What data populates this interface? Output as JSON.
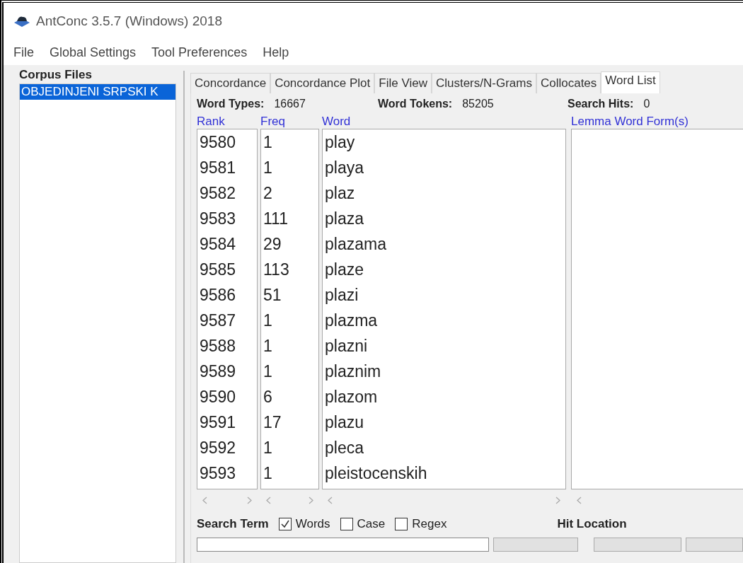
{
  "window": {
    "title": "AntConc 3.5.7 (Windows) 2018"
  },
  "menu": [
    "File",
    "Global Settings",
    "Tool Preferences",
    "Help"
  ],
  "corpus_files": {
    "heading": "Corpus Files",
    "items": [
      {
        "name": "OBJEDINJENI SRPSKI K",
        "selected": true
      }
    ]
  },
  "tabs": [
    {
      "label": "Concordance",
      "selected": false
    },
    {
      "label": "Concordance Plot",
      "selected": false
    },
    {
      "label": "File View",
      "selected": false
    },
    {
      "label": "Clusters/N-Grams",
      "selected": false
    },
    {
      "label": "Collocates",
      "selected": false
    },
    {
      "label": "Word List",
      "selected": true
    }
  ],
  "stats": [
    {
      "label": "Word Types:",
      "value": "16667"
    },
    {
      "label": "Word Tokens:",
      "value": "85205"
    },
    {
      "label": "Search Hits:",
      "value": "0"
    }
  ],
  "columns": [
    "Rank",
    "Freq",
    "Word"
  ],
  "lemma_column": "Lemma Word Form(s)",
  "rows": [
    {
      "rank": "9580",
      "freq": "1",
      "word": "play"
    },
    {
      "rank": "9581",
      "freq": "1",
      "word": "playa"
    },
    {
      "rank": "9582",
      "freq": "2",
      "word": "plaz"
    },
    {
      "rank": "9583",
      "freq": "111",
      "word": "plaza"
    },
    {
      "rank": "9584",
      "freq": "29",
      "word": "plazama"
    },
    {
      "rank": "9585",
      "freq": "113",
      "word": "plaze"
    },
    {
      "rank": "9586",
      "freq": "51",
      "word": "plazi"
    },
    {
      "rank": "9587",
      "freq": "1",
      "word": "plazma"
    },
    {
      "rank": "9588",
      "freq": "1",
      "word": "plazni"
    },
    {
      "rank": "9589",
      "freq": "1",
      "word": "plaznim"
    },
    {
      "rank": "9590",
      "freq": "6",
      "word": "plazom"
    },
    {
      "rank": "9591",
      "freq": "17",
      "word": "plazu"
    },
    {
      "rank": "9592",
      "freq": "1",
      "word": "pleca"
    },
    {
      "rank": "9593",
      "freq": "1",
      "word": "pleistocenskih"
    }
  ],
  "search": {
    "label": "Search Term",
    "options": [
      {
        "label": "Words",
        "checked": true
      },
      {
        "label": "Case",
        "checked": false
      },
      {
        "label": "Regex",
        "checked": false
      }
    ],
    "hit_location": "Hit Location"
  }
}
